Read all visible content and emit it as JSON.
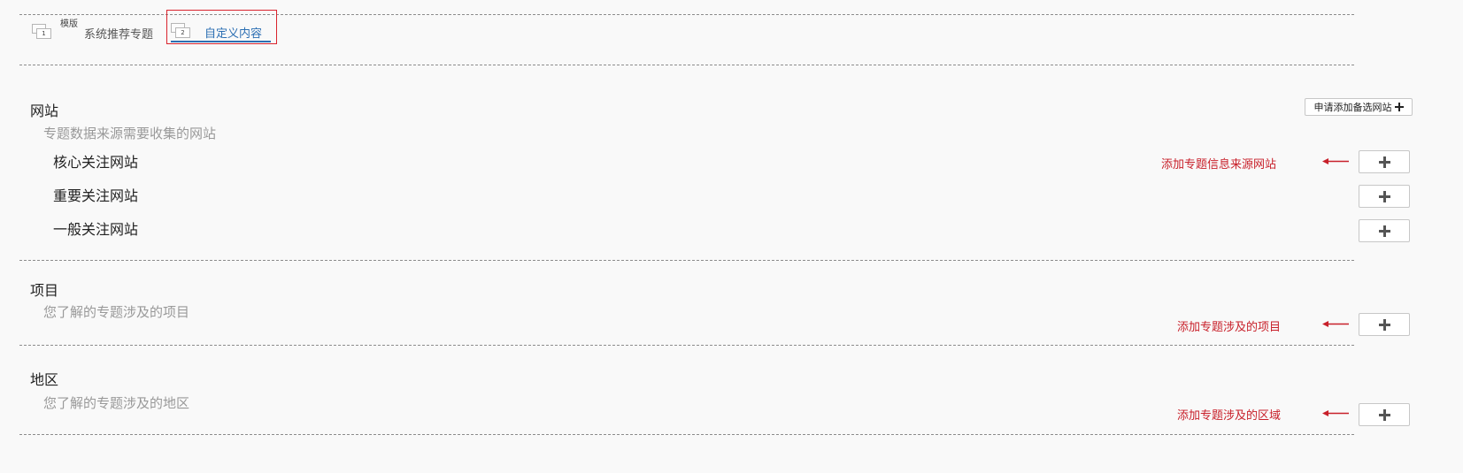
{
  "tabs": [
    {
      "number": "1",
      "caption": "模版",
      "label": "系统推荐专题"
    },
    {
      "number": "2",
      "label": "自定义内容"
    }
  ],
  "apply_button": {
    "label": "申请添加备选网站"
  },
  "sections": {
    "website": {
      "title": "网站",
      "description": "专题数据来源需要收集的网站",
      "rows": [
        "核心关注网站",
        "重要关注网站",
        "一般关注网站"
      ],
      "annotation": "添加专题信息来源网站"
    },
    "project": {
      "title": "项目",
      "description": "您了解的专题涉及的项目",
      "annotation": "添加专题涉及的项目"
    },
    "region": {
      "title": "地区",
      "description": "您了解的专题涉及的地区",
      "annotation": "添加专题涉及的区域"
    }
  },
  "colors": {
    "annotation": "#c8202a",
    "link": "#2c6fb3",
    "highlight_border": "#d9232d",
    "background": "#f9f9f9"
  },
  "icons": {
    "tab": "stacked-pages-icon",
    "add": "plus-icon",
    "arrow": "arrow-left-icon"
  }
}
